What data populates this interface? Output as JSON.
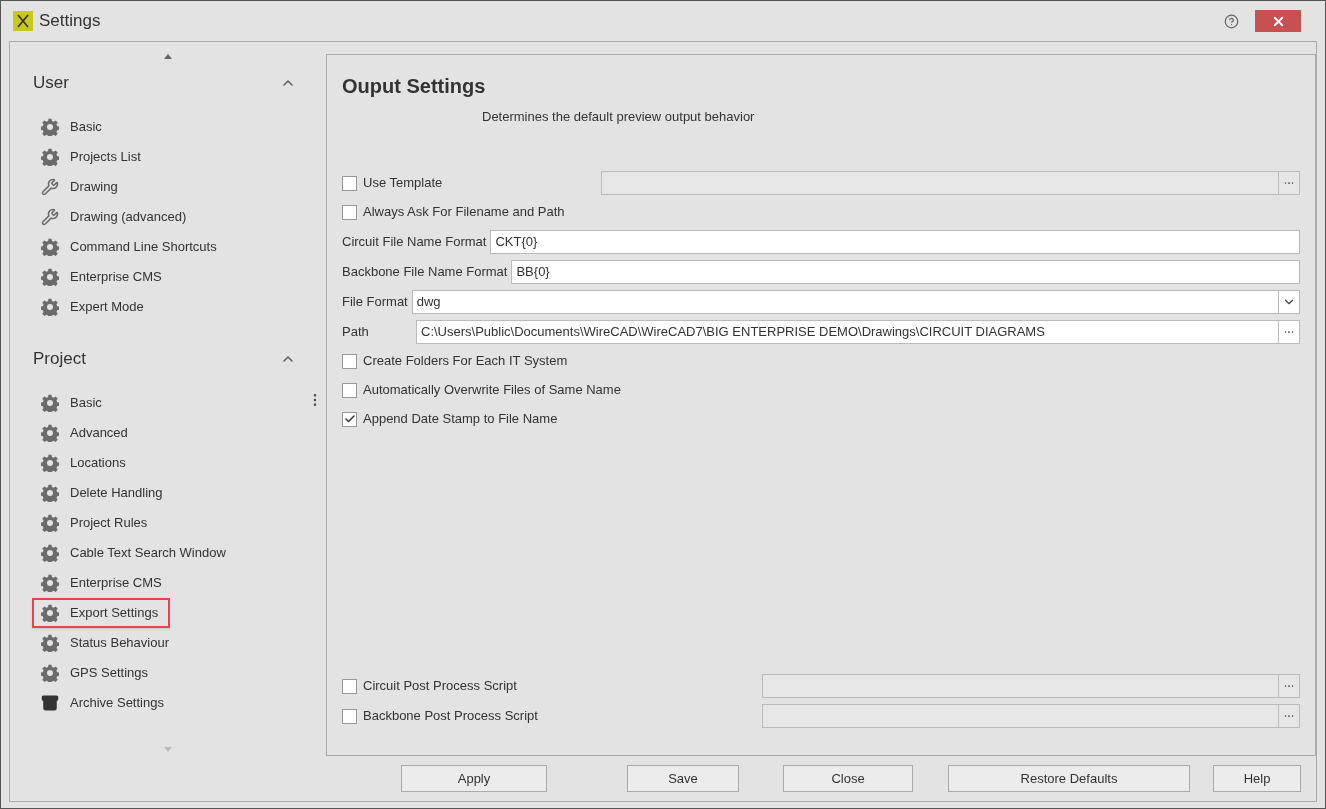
{
  "window": {
    "title": "Settings"
  },
  "sidebar": {
    "sections": [
      {
        "title": "User",
        "expanded": true,
        "items": [
          {
            "label": "Basic",
            "kind": "gear",
            "selected": false
          },
          {
            "label": "Projects List",
            "kind": "gear",
            "selected": false
          },
          {
            "label": "Drawing",
            "kind": "wrench",
            "selected": false
          },
          {
            "label": "Drawing (advanced)",
            "kind": "wrench",
            "selected": false
          },
          {
            "label": "Command Line Shortcuts",
            "kind": "gear",
            "selected": false
          },
          {
            "label": "Enterprise CMS",
            "kind": "gear",
            "selected": false
          },
          {
            "label": "Expert Mode",
            "kind": "gear",
            "selected": false
          }
        ]
      },
      {
        "title": "Project",
        "expanded": true,
        "items": [
          {
            "label": "Basic",
            "kind": "gear",
            "selected": false
          },
          {
            "label": "Advanced",
            "kind": "gear",
            "selected": false
          },
          {
            "label": "Locations",
            "kind": "gear",
            "selected": false
          },
          {
            "label": "Delete Handling",
            "kind": "gear",
            "selected": false
          },
          {
            "label": "Project Rules",
            "kind": "gear",
            "selected": false
          },
          {
            "label": "Cable Text Search Window",
            "kind": "gear",
            "selected": false
          },
          {
            "label": "Enterprise CMS",
            "kind": "gear",
            "selected": false
          },
          {
            "label": "Export Settings",
            "kind": "gear",
            "selected": true
          },
          {
            "label": "Status Behaviour",
            "kind": "gear",
            "selected": false
          },
          {
            "label": "GPS Settings",
            "kind": "gear",
            "selected": false
          },
          {
            "label": "Archive Settings",
            "kind": "archive",
            "selected": false
          }
        ]
      }
    ]
  },
  "panel": {
    "title": "Ouput Settings",
    "subtitle": "Determines the default preview output behavior",
    "rows": [
      {
        "kind": "checkbox_browse",
        "label": "Use Template",
        "checked": false
      },
      {
        "kind": "checkbox",
        "label": "Always Ask For Filename and Path",
        "checked": false
      },
      {
        "kind": "text",
        "label": "Circuit File Name Format",
        "value": "CKT{0}"
      },
      {
        "kind": "text",
        "label": "Backbone File Name Format",
        "value": "BB{0}"
      },
      {
        "kind": "dropdown",
        "label": "File Format",
        "value": "dwg"
      },
      {
        "kind": "path",
        "label": "Path",
        "value": "C:\\Users\\Public\\Documents\\WireCAD\\WireCAD7\\BIG ENTERPRISE DEMO\\Drawings\\CIRCUIT DIAGRAMS"
      },
      {
        "kind": "checkbox",
        "label": "Create Folders For Each IT System",
        "checked": false
      },
      {
        "kind": "checkbox",
        "label": "Automatically Overwrite Files of Same Name",
        "checked": false
      },
      {
        "kind": "checkbox",
        "label": "Append Date Stamp to File Name",
        "checked": true
      }
    ],
    "script_rows": [
      {
        "label": "Circuit Post Process Script",
        "checked": false
      },
      {
        "label": "Backbone Post Process Script",
        "checked": false
      }
    ]
  },
  "buttons": [
    "Apply",
    "Save",
    "Close",
    "Restore Defaults",
    "Help"
  ]
}
